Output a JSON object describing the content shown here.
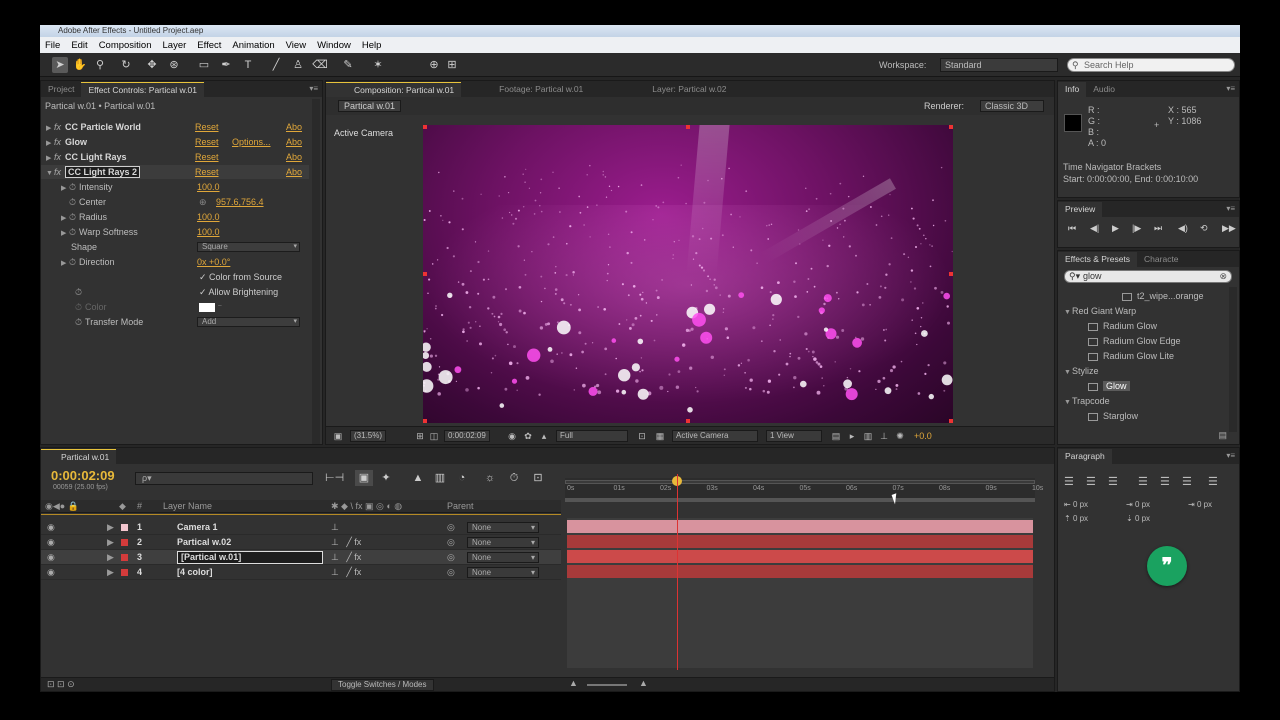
{
  "window": {
    "title": "Adobe After Effects - Untitled Project.aep"
  },
  "menu": [
    "File",
    "Edit",
    "Composition",
    "Layer",
    "Effect",
    "Animation",
    "View",
    "Window",
    "Help"
  ],
  "toolbar": {
    "workspace_label": "Workspace:",
    "workspace_value": "Standard",
    "search_placeholder": "Search Help"
  },
  "effect_controls": {
    "tabs": [
      "Project",
      "Effect Controls: Partical w.01"
    ],
    "header": "Partical w.01 • Partical w.01",
    "effects": [
      {
        "name": "CC Particle World",
        "reset": "Reset",
        "about": "Abo"
      },
      {
        "name": "Glow",
        "reset": "Reset",
        "options": "Options...",
        "about": "Abo"
      },
      {
        "name": "CC Light Rays",
        "reset": "Reset",
        "about": "Abo"
      },
      {
        "name": "CC Light Rays 2",
        "reset": "Reset",
        "about": "Abo"
      }
    ],
    "params": [
      {
        "name": "Intensity",
        "value": "100.0"
      },
      {
        "name": "Center",
        "value": "957.6,756.4"
      },
      {
        "name": "Radius",
        "value": "100.0"
      },
      {
        "name": "Warp Softness",
        "value": "100.0"
      },
      {
        "name": "Shape",
        "value": "Square"
      },
      {
        "name": "Direction",
        "value": "0x +0.0°"
      },
      {
        "name": "Color from Source",
        "value": "✓ Color from Source"
      },
      {
        "name": "Allow Brightening",
        "value": "✓ Allow Brightening"
      },
      {
        "name": "Color",
        "value": ""
      },
      {
        "name": "Transfer Mode",
        "value": "Add"
      }
    ]
  },
  "composition": {
    "tabs": [
      "Composition: Partical w.01",
      "Footage: Partical w.01",
      "Layer: Partical w.02"
    ],
    "crumb": "Partical w.01",
    "renderer_label": "Renderer:",
    "renderer_value": "Classic 3D",
    "camera_label": "Active Camera",
    "zoom": "(31.5%)",
    "timecode": "0:00:02:09",
    "resolution": "Full",
    "view_camera": "Active Camera",
    "views": "1 View",
    "exposure": "+0.0"
  },
  "info": {
    "tabs": [
      "Info",
      "Audio"
    ],
    "r": "R :",
    "g": "G :",
    "b": "B :",
    "a": "A : 0",
    "x": "X : 565",
    "y": "Y : 1086",
    "nav_title": "Time Navigator Brackets",
    "nav_range": "Start: 0:00:00:00, End: 0:00:10:00"
  },
  "preview": {
    "tab": "Preview"
  },
  "effects_presets": {
    "tabs": [
      "Effects & Presets",
      "Characte"
    ],
    "search_value": "glow",
    "items": [
      {
        "label": "t2_wipe...orange",
        "type": "preset",
        "indent": 2
      },
      {
        "label": "Red Giant Warp",
        "type": "group",
        "indent": 0
      },
      {
        "label": "Radium Glow",
        "type": "effect",
        "indent": 1
      },
      {
        "label": "Radium Glow Edge",
        "type": "effect",
        "indent": 1
      },
      {
        "label": "Radium Glow Lite",
        "type": "effect",
        "indent": 1
      },
      {
        "label": "Stylize",
        "type": "group",
        "indent": 0
      },
      {
        "label": "Glow",
        "type": "effect",
        "indent": 1,
        "highlight": true
      },
      {
        "label": "Trapcode",
        "type": "group",
        "indent": 0
      },
      {
        "label": "Starglow",
        "type": "effect",
        "indent": 1
      }
    ]
  },
  "paragraph": {
    "tab": "Paragraph",
    "px1": "0 px",
    "px2": "0 px",
    "px3": "0 px",
    "px4": "0 px",
    "px5": "0 px"
  },
  "timeline": {
    "tab": "Partical w.01",
    "timecode": "0:00:02:09",
    "fps": "00059 (25.00 fps)",
    "search_placeholder": "ρ▾",
    "col_layer": "Layer Name",
    "col_parent": "Parent",
    "layers": [
      {
        "num": "1",
        "name": "Camera 1",
        "parent": "None",
        "color": "#f3c6cf"
      },
      {
        "num": "2",
        "name": "Partical w.02",
        "parent": "None",
        "color": "#d33b3b"
      },
      {
        "num": "3",
        "name": "[Partical w.01]",
        "parent": "None",
        "color": "#d33b3b"
      },
      {
        "num": "4",
        "name": "[4 color]",
        "parent": "None",
        "color": "#d33b3b"
      }
    ],
    "ticks": [
      "0s",
      "01s",
      "02s",
      "03s",
      "04s",
      "05s",
      "06s",
      "07s",
      "08s",
      "09s",
      "10s"
    ],
    "toggle_label": "Toggle Switches / Modes"
  }
}
